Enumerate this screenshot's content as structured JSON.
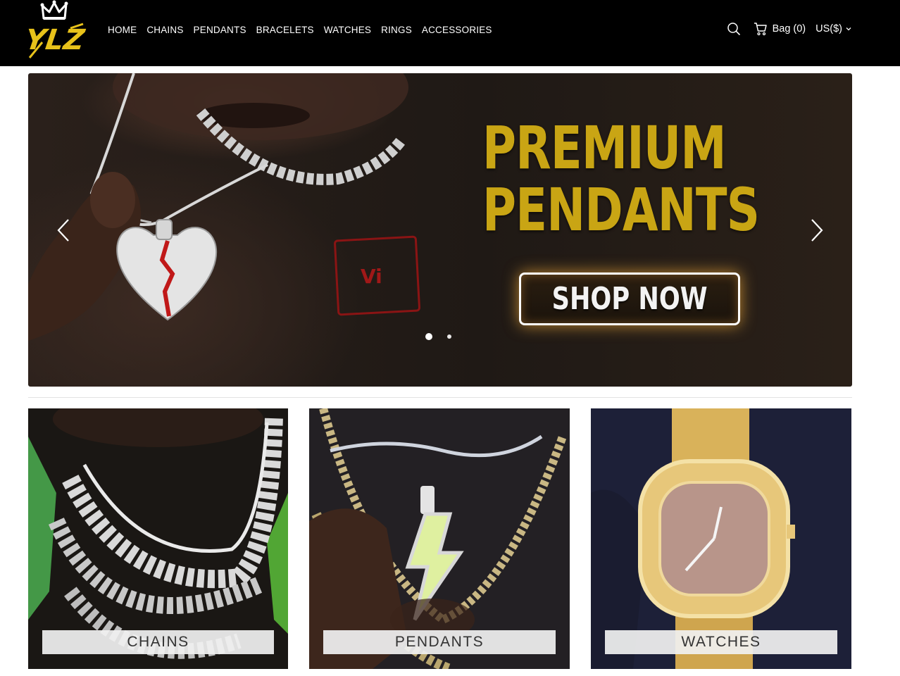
{
  "brand": {
    "logo_text": "YLZ"
  },
  "nav": {
    "items": [
      {
        "label": "HOME"
      },
      {
        "label": "CHAINS"
      },
      {
        "label": "PENDANTS"
      },
      {
        "label": "BRACELETS"
      },
      {
        "label": "WATCHES"
      },
      {
        "label": "RINGS"
      },
      {
        "label": "ACCESSORIES"
      }
    ]
  },
  "header_actions": {
    "search_icon": "search-icon",
    "bag_icon": "cart-icon",
    "bag_label": "Bag",
    "bag_count": "(0)",
    "currency": "US($)"
  },
  "hero": {
    "title_line1": "PREMIUM",
    "title_line2": "PENDANTS",
    "cta_label": "SHOP NOW",
    "shirt_print": "Vi",
    "slides_total": 2,
    "active_slide": 1,
    "colors": {
      "title": "#c9a514",
      "cta_glow": "#ffb43c"
    }
  },
  "categories": [
    {
      "label": "CHAINS"
    },
    {
      "label": "PENDANTS"
    },
    {
      "label": "WATCHES"
    }
  ],
  "colors": {
    "header_bg": "#000000",
    "accent_gold": "#e8c21a",
    "page_bg": "#ffffff"
  }
}
